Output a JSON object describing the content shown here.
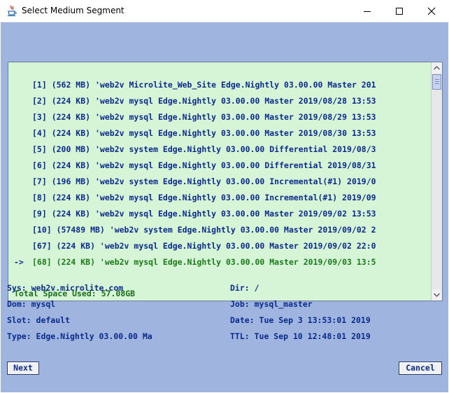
{
  "window": {
    "title": "Select Medium Segment",
    "icon": "java-coffee-cup-icon"
  },
  "list": {
    "rows": [
      {
        "marker": "",
        "text": "[1] (562 MB) 'web2v Microlite_Web_Site Edge.Nightly 03.00.00 Master 201"
      },
      {
        "marker": "",
        "text": "[2] (224 KB) 'web2v mysql Edge.Nightly 03.00.00 Master 2019/08/28 13:53"
      },
      {
        "marker": "",
        "text": "[3] (224 KB) 'web2v mysql Edge.Nightly 03.00.00 Master 2019/08/29 13:53"
      },
      {
        "marker": "",
        "text": "[4] (224 KB) 'web2v mysql Edge.Nightly 03.00.00 Master 2019/08/30 13:53"
      },
      {
        "marker": "",
        "text": "[5] (200 MB) 'web2v system Edge.Nightly 03.00.00 Differential 2019/08/3"
      },
      {
        "marker": "",
        "text": "[6] (224 KB) 'web2v mysql Edge.Nightly 03.00.00 Differential 2019/08/31"
      },
      {
        "marker": "",
        "text": "[7] (196 MB) 'web2v system Edge.Nightly 03.00.00 Incremental(#1) 2019/0"
      },
      {
        "marker": "",
        "text": "[8] (224 KB) 'web2v mysql Edge.Nightly 03.00.00 Incremental(#1) 2019/09"
      },
      {
        "marker": "",
        "text": "[9] (224 KB) 'web2v mysql Edge.Nightly 03.00.00 Master 2019/09/02 13:53"
      },
      {
        "marker": "",
        "text": "[10] (57489 MB) 'web2v system Edge.Nightly 03.00.00 Master 2019/09/02 2"
      },
      {
        "marker": "",
        "text": "[67] (224 KB) 'web2v mysql Edge.Nightly 03.00.00 Master 2019/09/02 22:0"
      },
      {
        "marker": "->",
        "text": "[68] (224 KB) 'web2v mysql Edge.Nightly 03.00.00 Master 2019/09/03 13:5"
      }
    ],
    "selected_index": 11,
    "total": "Total Space Used: 57.08GB"
  },
  "info": {
    "sys": "Sys: web2v.microlite.com",
    "dom": "Dom: mysql",
    "slot": "Slot: default",
    "type": "Type: Edge.Nightly 03.00.00 Ma",
    "dir": "Dir: /",
    "job": "Job: mysql_master",
    "date": "Date: Tue Sep  3 13:53:01 2019",
    "ttl": "TTL: Tue Sep 10 12:48:01 2019"
  },
  "buttons": {
    "next": "Next",
    "cancel": "Cancel"
  },
  "colors": {
    "client_bg": "#9fb5e0",
    "list_bg": "#d6f5d6",
    "text": "#0b2a8c",
    "selected_text": "#1a7a1a"
  }
}
